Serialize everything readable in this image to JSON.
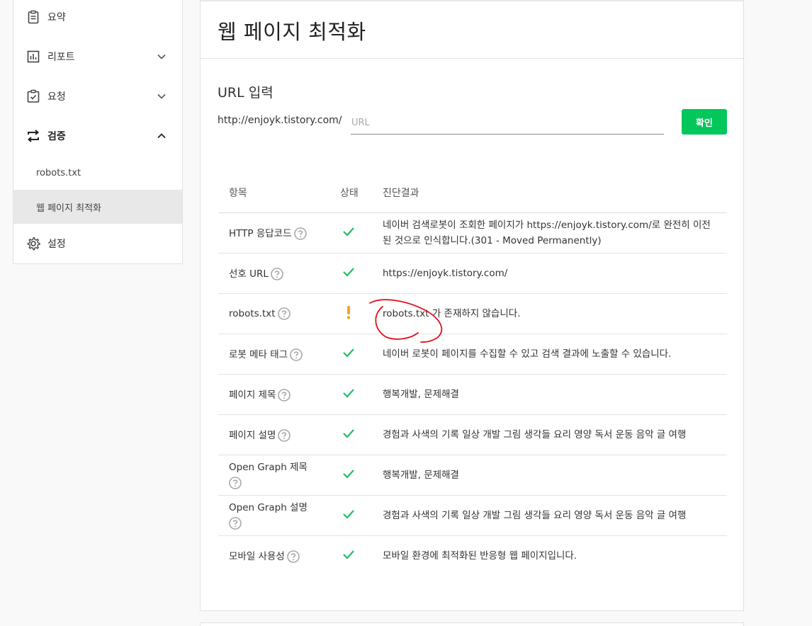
{
  "sidebar": {
    "items": [
      {
        "label": "요약",
        "icon": "clipboard-icon"
      },
      {
        "label": "리포트",
        "icon": "bar-chart-icon"
      },
      {
        "label": "요청",
        "icon": "clipboard-check-icon"
      },
      {
        "label": "검증",
        "icon": "swap-arrows-icon"
      },
      {
        "label": "설정",
        "icon": "gear-icon"
      }
    ],
    "sub_items": [
      {
        "label": "robots.txt"
      },
      {
        "label": "웹 페이지 최적화"
      }
    ]
  },
  "main": {
    "title": "웹 페이지 최적화",
    "url_section_label": "URL 입력",
    "url_prefix": "http://enjoyk.tistory.com/",
    "url_placeholder": "URL",
    "url_value": "",
    "confirm_label": "확인"
  },
  "table": {
    "headers": [
      "항목",
      "상태",
      "진단결과"
    ],
    "rows": [
      {
        "item": "HTTP 응답코드",
        "status": "ok",
        "result": "네이버 검색로봇이 조회한 페이지가 https://enjoyk.tistory.com/로 완전히 이전된 것으로 인식합니다.(301 - Moved Permanently)"
      },
      {
        "item": "선호 URL",
        "status": "ok",
        "result": "https://enjoyk.tistory.com/"
      },
      {
        "item": "robots.txt",
        "status": "warning",
        "result": "robots.txt 가 존재하지 않습니다."
      },
      {
        "item": "로봇 메타 태그",
        "status": "ok",
        "result": "네이버 로봇이 페이지를 수집할 수 있고 검색 결과에 노출할 수 있습니다."
      },
      {
        "item": "페이지 제목",
        "status": "ok",
        "result": "행복개발, 문제해결"
      },
      {
        "item": "페이지 설명",
        "status": "ok",
        "result": "경험과 사색의 기록 일상 개발 그림 생각들 요리 영양 독서 운동 음악 글 여행"
      },
      {
        "item": "Open Graph 제목",
        "status": "ok",
        "result": "행복개발, 문제해결"
      },
      {
        "item": "Open Graph 설명",
        "status": "ok",
        "result": "경험과 사색의 기록 일상 개발 그림 생각들 요리 영양 독서 운동 음악 글 여행"
      },
      {
        "item": "모바일 사용성",
        "status": "ok",
        "result": "모바일 환경에 최적화된 반응형 웹 페이지입니다."
      }
    ]
  },
  "colors": {
    "accent_green": "#03c75a",
    "ok_check": "#1fbf5f",
    "warning": "#f5a623",
    "annotation_red": "#e0101a"
  }
}
